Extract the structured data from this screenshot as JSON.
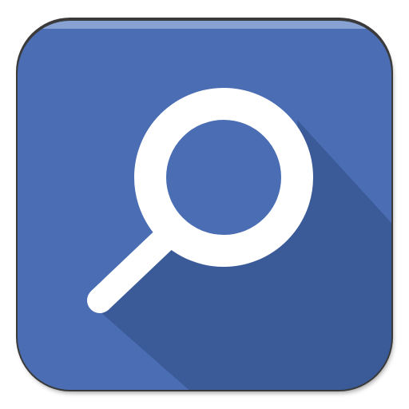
{
  "app_icon": {
    "icon": "search-icon",
    "tile_color": "#4A6DB3",
    "tile_highlight_color": "#8EA6D6",
    "long_shadow_color": "#2E4A82",
    "glyph_color": "#FFFFFF",
    "frame_shadow_color": "#3A3A3A"
  }
}
